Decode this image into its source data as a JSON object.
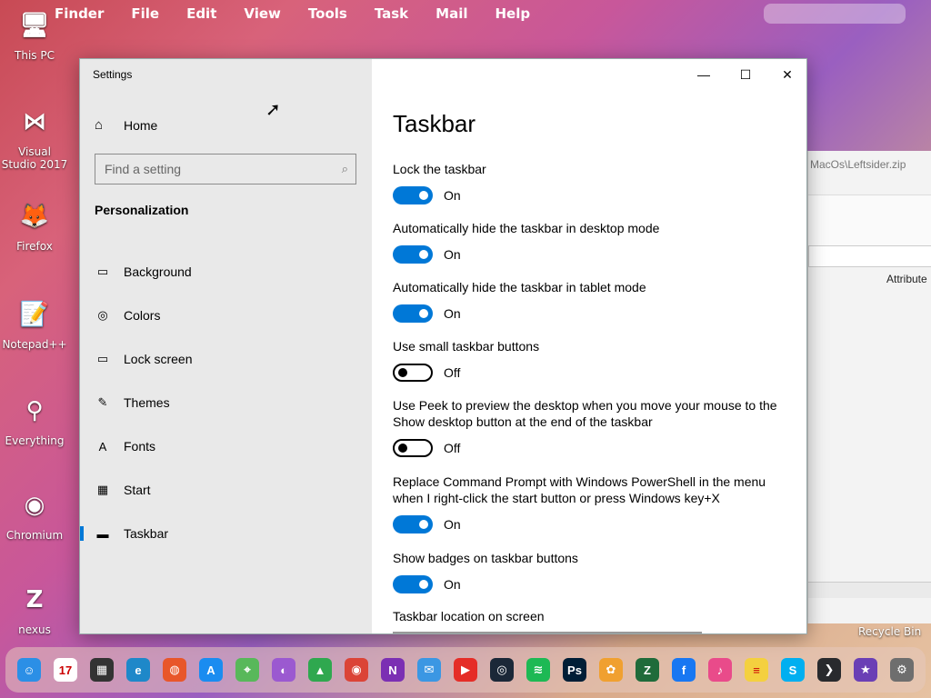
{
  "menubar": {
    "apple_icon": "apple-icon",
    "items": [
      "Finder",
      "File",
      "Edit",
      "View",
      "Tools",
      "Task",
      "Mail",
      "Help"
    ]
  },
  "desktop_icons": [
    {
      "label": "This PC",
      "icon": "computer-icon",
      "glyph": "🖥"
    },
    {
      "label": "Visual Studio 2017",
      "icon": "visual-studio-icon",
      "glyph": "⋈"
    },
    {
      "label": "Firefox",
      "icon": "firefox-icon",
      "glyph": "🦊"
    },
    {
      "label": "Notepad++",
      "icon": "notepad-plus-plus-icon",
      "glyph": "📝"
    },
    {
      "label": "Everything",
      "icon": "everything-search-icon",
      "glyph": "⚲"
    },
    {
      "label": "Chromium",
      "icon": "chromium-icon",
      "glyph": "◉"
    },
    {
      "label": "nexus",
      "icon": "nexus-icon",
      "glyph": "Z"
    }
  ],
  "background_window": {
    "path_text": "MacOs\\Leftsider.zip",
    "column_header": "Attribute"
  },
  "recycle_bin_label": "Recycle Bin",
  "settings": {
    "window_title": "Settings",
    "home_label": "Home",
    "search_placeholder": "Find a setting",
    "section_title": "Personalization",
    "nav": [
      {
        "label": "Background",
        "icon": "background-image-icon",
        "glyph": "▭"
      },
      {
        "label": "Colors",
        "icon": "palette-icon",
        "glyph": "◎"
      },
      {
        "label": "Lock screen",
        "icon": "lock-screen-icon",
        "glyph": "▭"
      },
      {
        "label": "Themes",
        "icon": "themes-brush-icon",
        "glyph": "✎"
      },
      {
        "label": "Fonts",
        "icon": "fonts-icon",
        "glyph": "A"
      },
      {
        "label": "Start",
        "icon": "start-tiles-icon",
        "glyph": "▦"
      },
      {
        "label": "Taskbar",
        "icon": "taskbar-icon",
        "glyph": "▬",
        "active": true
      }
    ],
    "page_title": "Taskbar",
    "options": [
      {
        "label": "Lock the taskbar",
        "state": "On",
        "on": true
      },
      {
        "label": "Automatically hide the taskbar in desktop mode",
        "state": "On",
        "on": true
      },
      {
        "label": "Automatically hide the taskbar in tablet mode",
        "state": "On",
        "on": true
      },
      {
        "label": "Use small taskbar buttons",
        "state": "Off",
        "on": false
      },
      {
        "label": "Use Peek to preview the desktop when you move your mouse to the Show desktop button at the end of the taskbar",
        "state": "Off",
        "on": false
      },
      {
        "label": "Replace Command Prompt with Windows PowerShell in the menu when I right-click the start button or press Windows key+X",
        "state": "On",
        "on": true
      },
      {
        "label": "Show badges on taskbar buttons",
        "state": "On",
        "on": true
      }
    ],
    "location_label": "Taskbar location on screen",
    "accent_color": "#0078d7"
  },
  "dock": [
    {
      "icon": "finder-icon",
      "color": "#2b8fe6",
      "glyph": "☺"
    },
    {
      "icon": "calendar-icon",
      "color": "#ffffff",
      "glyph": "17"
    },
    {
      "icon": "calculator-icon",
      "color": "#333333",
      "glyph": "▦"
    },
    {
      "icon": "edge-icon",
      "color": "#1e88c9",
      "glyph": "e"
    },
    {
      "icon": "firefox-dock-icon",
      "color": "#e8562a",
      "glyph": "◍"
    },
    {
      "icon": "app-store-icon",
      "color": "#1a8cf0",
      "glyph": "A"
    },
    {
      "icon": "maps-icon",
      "color": "#58b85a",
      "glyph": "⌖"
    },
    {
      "icon": "siri-icon",
      "color": "#9b59d0",
      "glyph": "◐"
    },
    {
      "icon": "google-drive-icon",
      "color": "#2fa84f",
      "glyph": "▲"
    },
    {
      "icon": "chrome-icon",
      "color": "#db4437",
      "glyph": "◉"
    },
    {
      "icon": "onenote-icon",
      "color": "#7b2fb3",
      "glyph": "N"
    },
    {
      "icon": "mail-icon",
      "color": "#3b97e3",
      "glyph": "✉"
    },
    {
      "icon": "youtube-icon",
      "color": "#e52d27",
      "glyph": "▶"
    },
    {
      "icon": "steam-icon",
      "color": "#1b2838",
      "glyph": "◎"
    },
    {
      "icon": "spotify-icon",
      "color": "#1db954",
      "glyph": "≋"
    },
    {
      "icon": "photoshop-icon",
      "color": "#001e36",
      "glyph": "Ps"
    },
    {
      "icon": "photos-icon",
      "color": "#f0a030",
      "glyph": "✿"
    },
    {
      "icon": "zendesk-icon",
      "color": "#1f6b3a",
      "glyph": "Z"
    },
    {
      "icon": "facebook-icon",
      "color": "#1877f2",
      "glyph": "f"
    },
    {
      "icon": "itunes-icon",
      "color": "#e94b8a",
      "glyph": "♪"
    },
    {
      "icon": "notes-icon",
      "color": "#f4d03f",
      "glyph": "≡"
    },
    {
      "icon": "skype-icon",
      "color": "#00aff0",
      "glyph": "S"
    },
    {
      "icon": "plex-icon",
      "color": "#282a2d",
      "glyph": "❯"
    },
    {
      "icon": "imovie-icon",
      "color": "#6a3fb5",
      "glyph": "★"
    },
    {
      "icon": "system-preferences-icon",
      "color": "#6e6e6e",
      "glyph": "⚙"
    }
  ]
}
